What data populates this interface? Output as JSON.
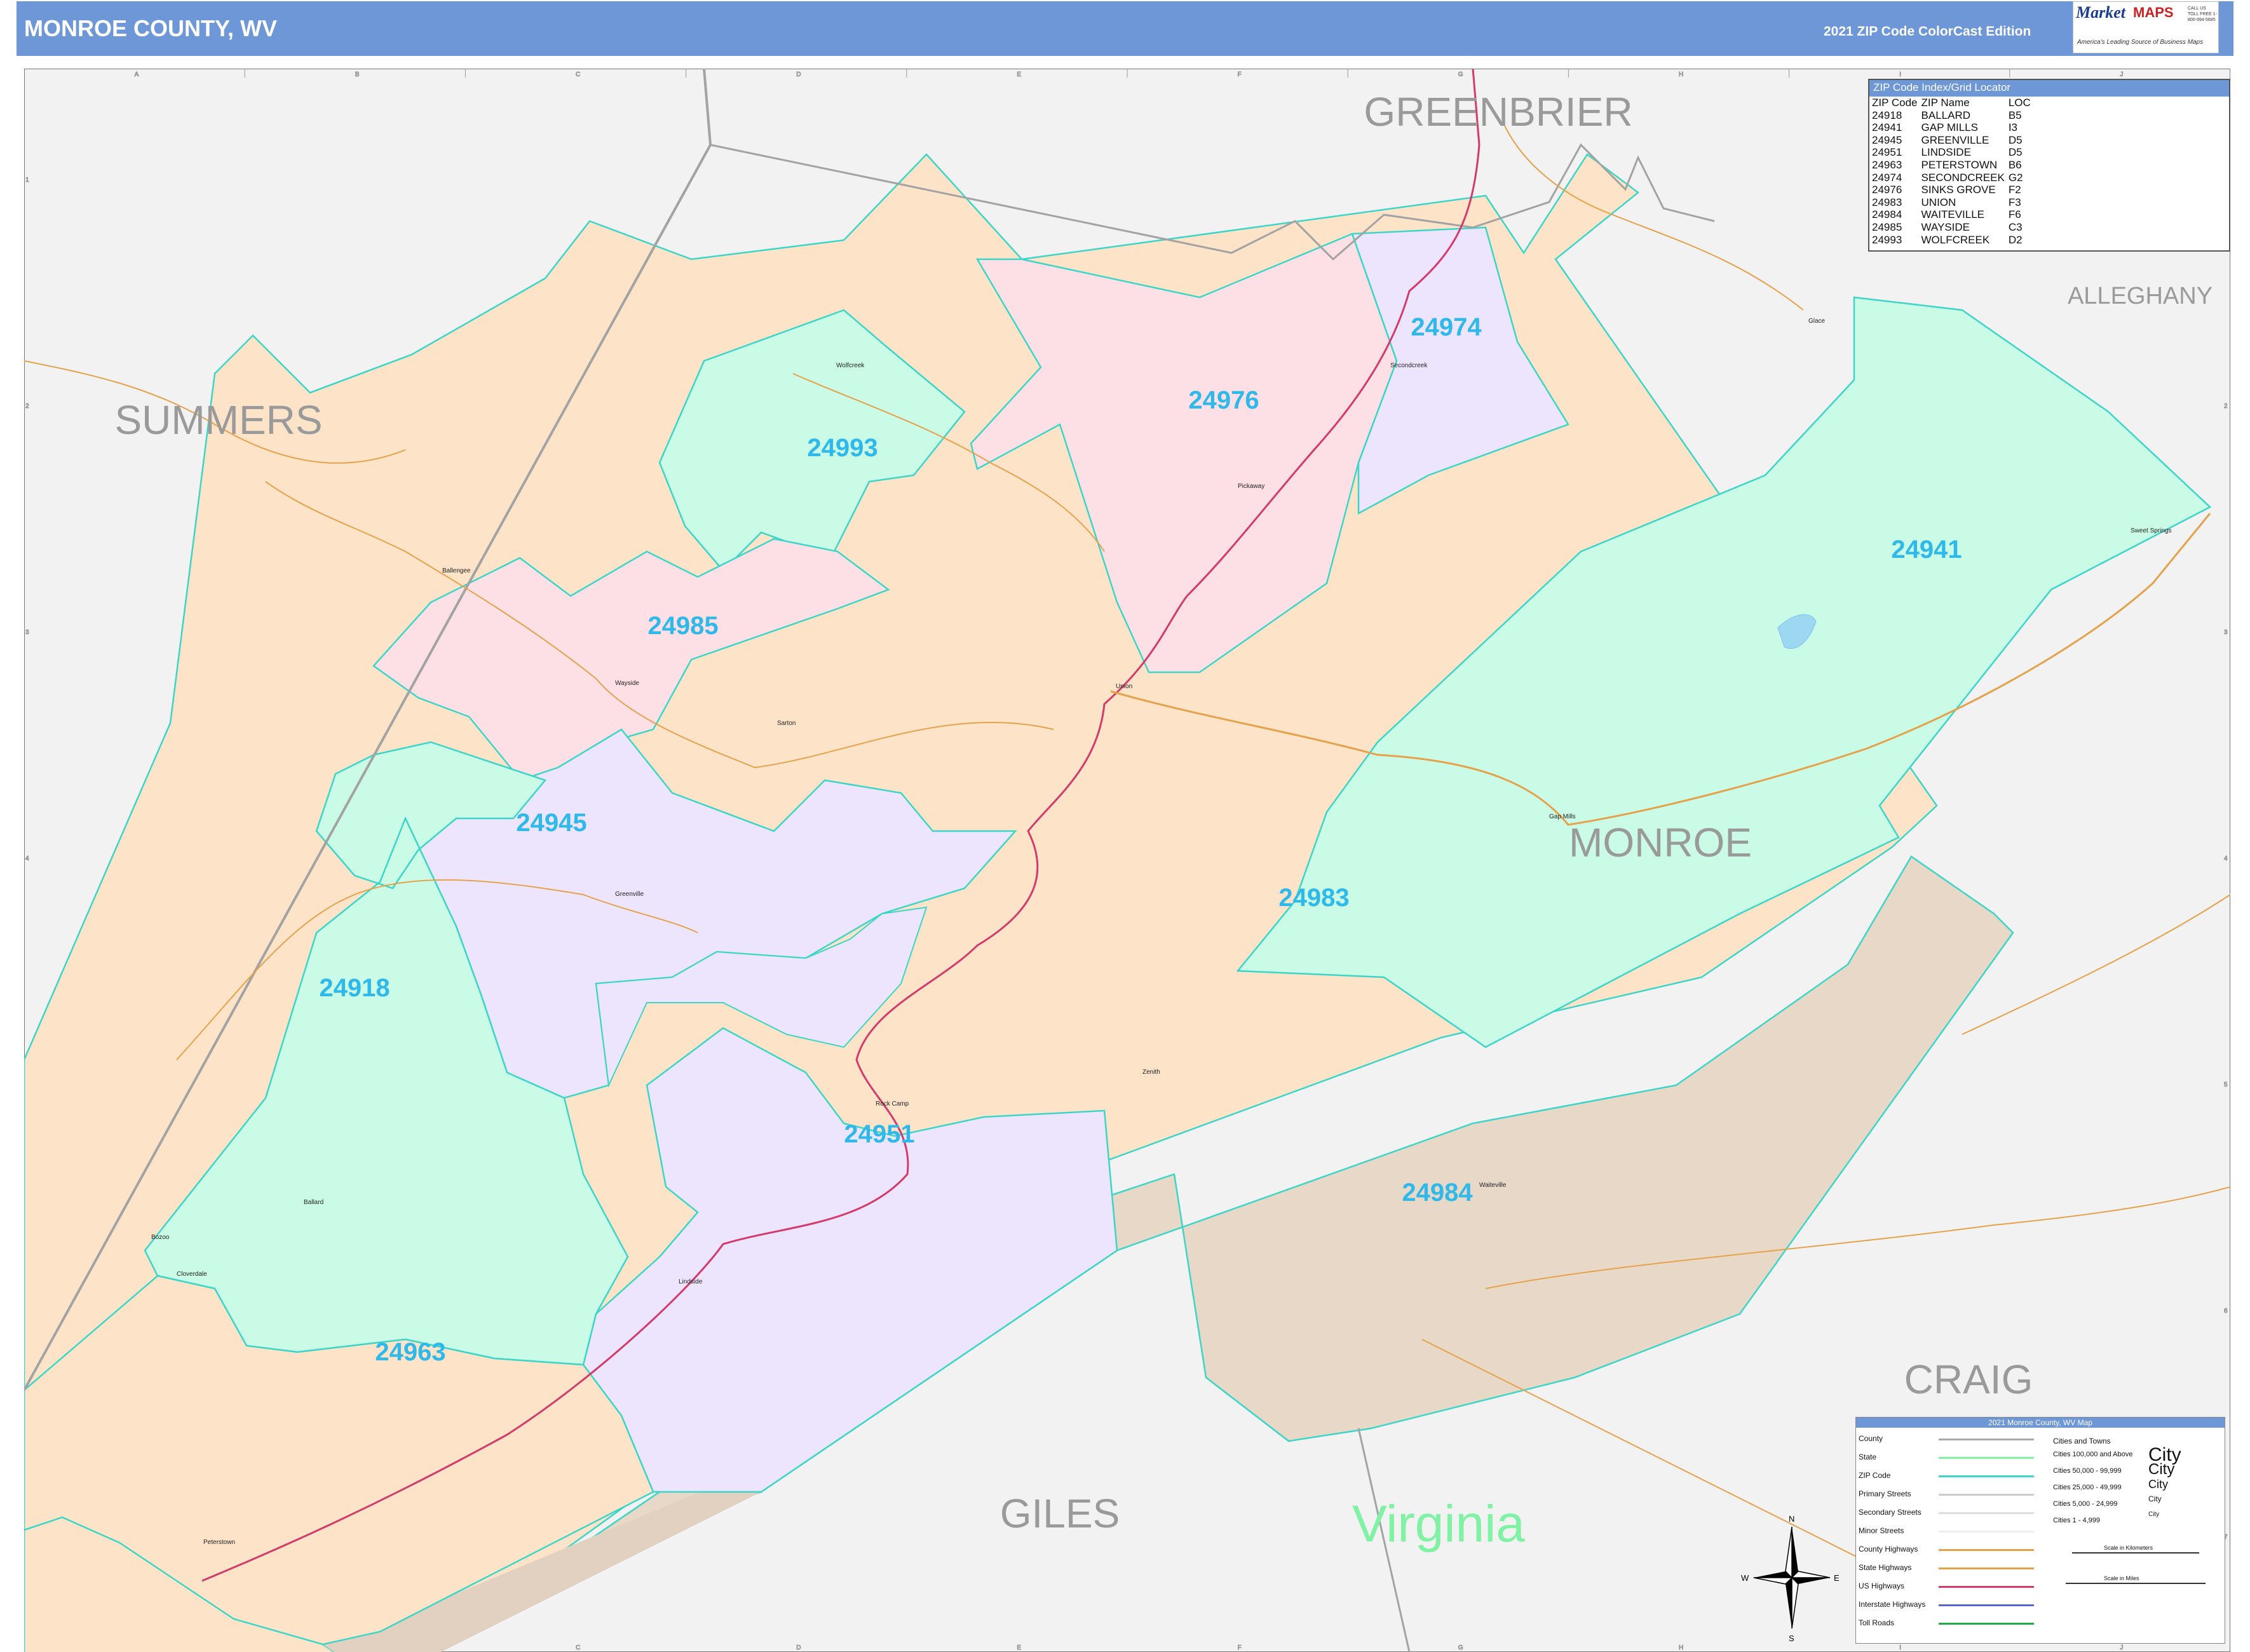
{
  "header": {
    "title": "MONROE COUNTY, WV",
    "edition": "2021 ZIP Code ColorCast Edition"
  },
  "logo": {
    "brand_top": "Market",
    "brand_bottom": "MAPS",
    "tagline": "America's Leading Source of Business Maps",
    "slogan": "On Target. On Time.",
    "contact": "CALL US TOLL FREE 1-800-994-5685"
  },
  "grid": {
    "columns": [
      "A",
      "B",
      "C",
      "D",
      "E",
      "F",
      "G",
      "H",
      "I",
      "J"
    ],
    "rows": [
      "1",
      "2",
      "3",
      "4",
      "5",
      "6",
      "7"
    ]
  },
  "counties": {
    "greenbrier": "GREENBRIER",
    "summers": "SUMMERS",
    "alleghany": "ALLEGHANY",
    "monroe": "MONROE",
    "craig": "CRAIG",
    "giles": "GILES",
    "state": "Virginia"
  },
  "zip_labels": {
    "z24974": "24974",
    "z24976": "24976",
    "z24993": "24993",
    "z24941": "24941",
    "z24985": "24985",
    "z24945": "24945",
    "z24983": "24983",
    "z24918": "24918",
    "z24951": "24951",
    "z24984": "24984",
    "z24963": "24963"
  },
  "colors": {
    "zip_24983": "#fde3c8",
    "zip_24941": "#c9fbe6",
    "zip_24976": "#fde0e6",
    "zip_24945": "#ece5fd",
    "zip_24984": "#e8d8c8",
    "zip_boundary": "#3bd6c8",
    "zip_label": "#2fb9ea",
    "county_label": "#9a9a9a",
    "virginia_label": "#7ff2a4",
    "header": "#6d97d6"
  },
  "places": {
    "glace": "Glace",
    "secondcreek": "Secondcreek",
    "pickaway": "Pickaway",
    "wolfcreek": "Wolfcreek",
    "sweet_springs": "Sweet Springs",
    "ballengee": "Ballengee",
    "wayside": "Wayside",
    "union": "Union",
    "sarton": "Sarton",
    "gap_mills": "Gap Mills",
    "greenville": "Greenville",
    "zenith": "Zenith",
    "rock_camp": "Rock Camp",
    "waiteville": "Waiteville",
    "ballard": "Ballard",
    "bozoo": "Bozoo",
    "lindside": "Lindside",
    "cloverdale": "Cloverdale",
    "peterstown": "Peterstown"
  },
  "zip_index": {
    "title": "ZIP Code Index/Grid Locator",
    "headers": [
      "ZIP Code",
      "ZIP Name",
      "LOC"
    ],
    "rows": [
      [
        "24918",
        "BALLARD",
        "B5"
      ],
      [
        "24941",
        "GAP MILLS",
        "I3"
      ],
      [
        "24945",
        "GREENVILLE",
        "D5"
      ],
      [
        "24951",
        "LINDSIDE",
        "D5"
      ],
      [
        "24963",
        "PETERSTOWN",
        "B6"
      ],
      [
        "24974",
        "SECONDCREEK",
        "G2"
      ],
      [
        "24976",
        "SINKS GROVE",
        "F2"
      ],
      [
        "24983",
        "UNION",
        "F3"
      ],
      [
        "24984",
        "WAITEVILLE",
        "F6"
      ],
      [
        "24985",
        "WAYSIDE",
        "C3"
      ],
      [
        "24993",
        "WOLFCREEK",
        "D2"
      ]
    ]
  },
  "legend": {
    "title": "2021 Monroe County, WV Map",
    "left_items": [
      "County",
      "State",
      "ZIP Code",
      "Primary Streets",
      "Secondary Streets",
      "Minor Streets",
      "County Highways",
      "State Highways",
      "US Highways",
      "Interstate Highways",
      "Toll Roads"
    ],
    "cities_title": "Cities and Towns",
    "city_items": [
      "Cities 100,000 and Above",
      "Cities 50,000 - 99,999",
      "Cities 25,000 - 49,999",
      "Cities 5,000 - 24,999",
      "Cities 1 - 4,999"
    ],
    "city_samples": [
      "City",
      "City",
      "City",
      "City",
      "City"
    ],
    "scale_km": "Scale in Kilometers",
    "scale_mi": "Scale in Miles"
  },
  "compass": {
    "n": "N",
    "s": "S",
    "e": "E",
    "w": "W"
  }
}
